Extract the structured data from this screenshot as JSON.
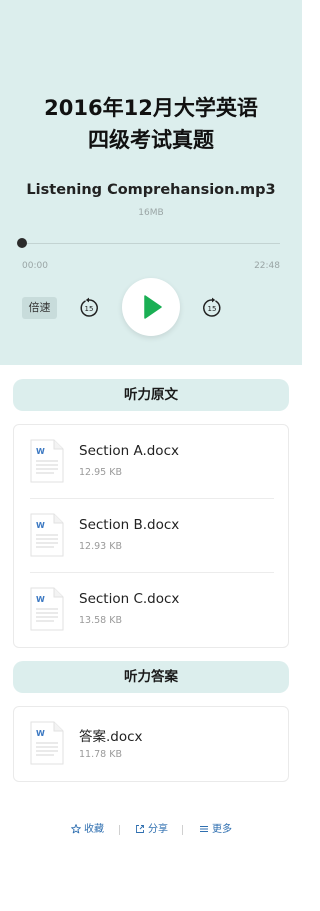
{
  "player": {
    "title_line1": "2016年12月大学英语",
    "title_line2": "四级考试真题",
    "file_name": "Listening Comprehansion.mp3",
    "file_size": "16MB",
    "current_time": "00:00",
    "total_time": "22:48",
    "progress": 0,
    "speed_label": "倍速",
    "skip_back_label": "15",
    "skip_forward_label": "15"
  },
  "transcript": {
    "header": "听力原文",
    "files": [
      {
        "name": "Section A.docx",
        "size": "12.95 KB",
        "icon": "word-doc-icon"
      },
      {
        "name": "Section B.docx",
        "size": "12.93 KB",
        "icon": "word-doc-icon"
      },
      {
        "name": "Section C.docx",
        "size": "13.58 KB",
        "icon": "word-doc-icon"
      }
    ]
  },
  "answers": {
    "header": "听力答案",
    "files": [
      {
        "name": "答案.docx",
        "size": "11.78 KB",
        "icon": "word-doc-icon"
      }
    ]
  },
  "actions": {
    "favorite_label": "收藏",
    "share_label": "分享",
    "more_label": "更多"
  },
  "colors": {
    "player_bg": "#dceeed",
    "play_green": "#1aaf54",
    "link_blue": "#2f6fb0",
    "word_blue": "#3b78c2"
  }
}
